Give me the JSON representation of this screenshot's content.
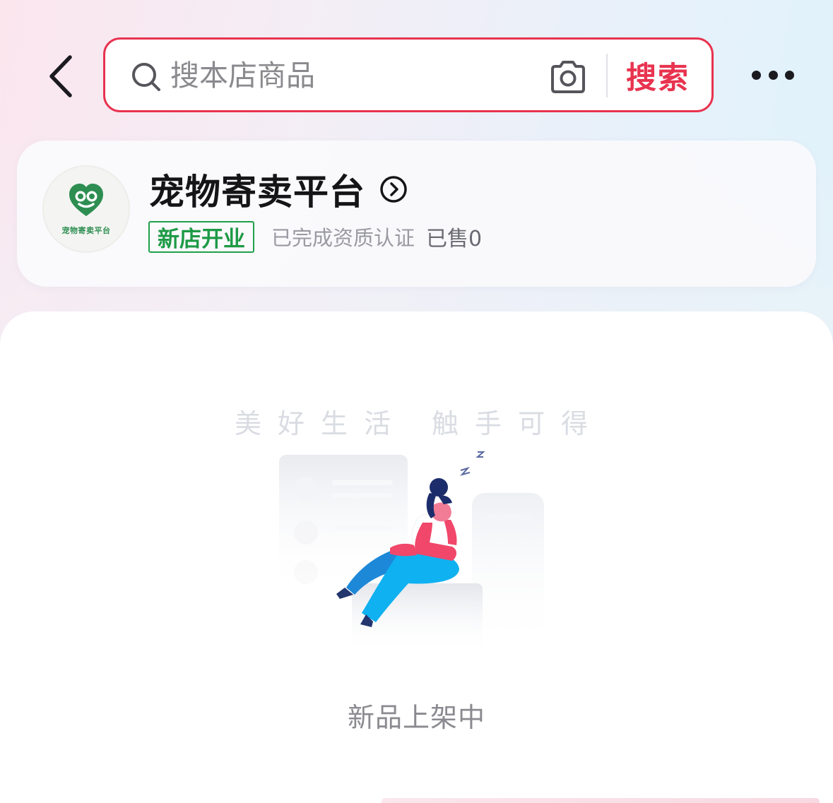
{
  "header": {
    "back_icon": "chevron-left-icon",
    "search": {
      "placeholder": "搜本店商品",
      "value": "",
      "search_icon": "search-icon",
      "camera_icon": "camera-icon",
      "button_label": "搜索",
      "accent_color": "#e8334f"
    },
    "more_icon": "more-dots-icon"
  },
  "store": {
    "logo_text": "宠物寄卖平台",
    "logo_icon": "heart-face-logo",
    "logo_color": "#2e8e52",
    "name": "宠物寄卖平台",
    "arrow_icon": "chevron-circle-right-icon",
    "badge": "新店开业",
    "badge_color": "#21a04a",
    "certified": "已完成资质认证",
    "sold": "已售0"
  },
  "main": {
    "slogan": "美好生活 触手可得",
    "illustration": "person-relaxing-illustration",
    "empty_text": "新品上架中"
  }
}
